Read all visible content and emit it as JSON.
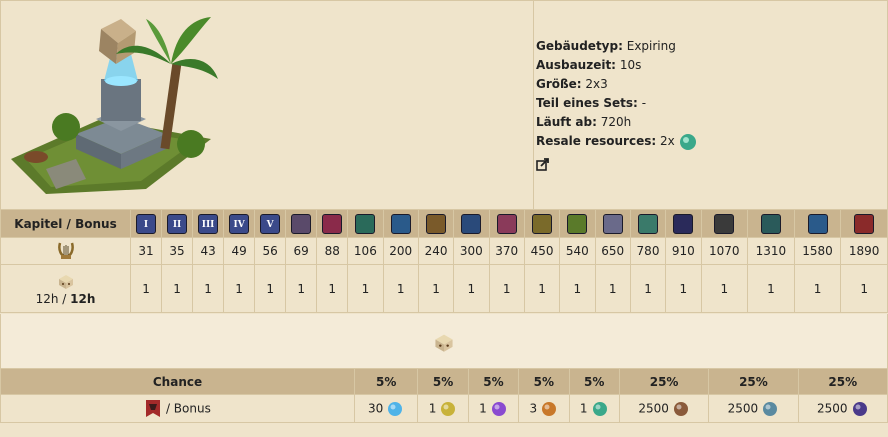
{
  "info": {
    "building_type_label": "Gebäudetyp:",
    "building_type_value": "Expiring",
    "build_time_label": "Ausbauzeit:",
    "build_time_value": "10s",
    "size_label": "Größe:",
    "size_value": "2x3",
    "set_label": "Teil eines Sets:",
    "set_value": "-",
    "expires_label": "Läuft ab:",
    "expires_value": "720h",
    "resale_label": "Resale resources:",
    "resale_value": "2x"
  },
  "era_table": {
    "header_label": "Kapitel / Bonus",
    "eras": [
      {
        "label": "I",
        "color": "#3b4a8a"
      },
      {
        "label": "II",
        "color": "#3b4a8a"
      },
      {
        "label": "III",
        "color": "#3b4a8a"
      },
      {
        "label": "IV",
        "color": "#3b4a8a"
      },
      {
        "label": "V",
        "color": "#3b4a8a"
      },
      {
        "label": "",
        "color": "#5a4a6a"
      },
      {
        "label": "",
        "color": "#8a2a4a"
      },
      {
        "label": "",
        "color": "#2a6a5a"
      },
      {
        "label": "",
        "color": "#2a5a8a"
      },
      {
        "label": "",
        "color": "#7a5a2a"
      },
      {
        "label": "",
        "color": "#2a4a7a"
      },
      {
        "label": "",
        "color": "#8a3a5a"
      },
      {
        "label": "",
        "color": "#7a6a2a"
      },
      {
        "label": "",
        "color": "#5a7a2a"
      },
      {
        "label": "",
        "color": "#6a6a8a"
      },
      {
        "label": "",
        "color": "#3a7a6a"
      },
      {
        "label": "",
        "color": "#2a2a5a"
      },
      {
        "label": "",
        "color": "#3a3a3a"
      },
      {
        "label": "",
        "color": "#2a5a5a"
      },
      {
        "label": "",
        "color": "#2a5a8a"
      },
      {
        "label": "",
        "color": "#8a2a2a"
      }
    ],
    "production_values": [
      "31",
      "35",
      "43",
      "49",
      "56",
      "69",
      "88",
      "106",
      "200",
      "240",
      "300",
      "370",
      "450",
      "540",
      "650",
      "780",
      "910",
      "1070",
      "1310",
      "1580",
      "1890"
    ],
    "stack_values": [
      "1",
      "1",
      "1",
      "1",
      "1",
      "1",
      "1",
      "1",
      "1",
      "1",
      "1",
      "1",
      "1",
      "1",
      "1",
      "1",
      "1",
      "1",
      "1",
      "1",
      "1"
    ],
    "time_label_normal": "12h /",
    "time_label_bold": "12h"
  },
  "chance_table": {
    "header_label": "Chance",
    "row_label": "/ Bonus",
    "chances": [
      "5%",
      "5%",
      "5%",
      "5%",
      "5%",
      "25%",
      "25%",
      "25%"
    ],
    "rewards": [
      {
        "amount": "30",
        "icon": "diamond-icon",
        "color": "#4fb3e8"
      },
      {
        "amount": "1",
        "icon": "potion-icon",
        "color": "#c8b23a"
      },
      {
        "amount": "1",
        "icon": "crystal-icon",
        "color": "#8a4ad0"
      },
      {
        "amount": "3",
        "icon": "book-icon",
        "color": "#c8782a"
      },
      {
        "amount": "1",
        "icon": "orb-icon",
        "color": "#3aa88a"
      },
      {
        "amount": "2500",
        "icon": "barrel-icon",
        "color": "#8a5a3a"
      },
      {
        "amount": "2500",
        "icon": "cloth-icon",
        "color": "#5a8aa0"
      },
      {
        "amount": "2500",
        "icon": "pearls-icon",
        "color": "#4a3a8a"
      }
    ]
  }
}
